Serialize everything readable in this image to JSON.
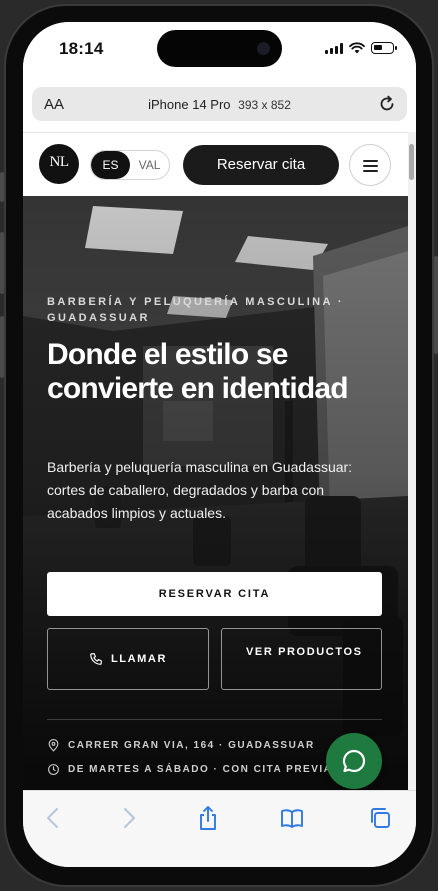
{
  "status_bar": {
    "time": "18:14"
  },
  "browser": {
    "text_size_label": "AA",
    "device_label": "iPhone 14 Pro",
    "viewport": "393 x 852"
  },
  "header": {
    "logo_text": "NL",
    "lang_options": [
      "ES",
      "VAL"
    ],
    "active_lang": "ES",
    "book_button": "Reservar cita"
  },
  "hero": {
    "eyebrow": "BARBERÍA Y PELUQUERÍA MASCULINA · GUADASSUAR",
    "title": "Donde el estilo se convierte en identidad",
    "description": "Barbería y peluquería masculina en Guadassuar: cortes de caballero, degradados y barba con acabados limpios y actuales.",
    "primary_cta": "RESERVAR CITA",
    "call_cta": "LLAMAR",
    "products_cta": "VER PRODUCTOS",
    "address": "CARRER GRAN VIA, 164 · GUADASSUAR",
    "schedule": "DE MARTES A SÁBADO · CON CITA PREVIA"
  },
  "icons": {
    "whatsapp": "chat-bubble-icon",
    "location": "map-pin-icon",
    "clock": "clock-icon",
    "phone": "phone-icon"
  },
  "colors": {
    "primary_dark": "#1b1b1b",
    "whatsapp_green": "#1e7a3e",
    "safari_blue": "#2f7ae5"
  }
}
